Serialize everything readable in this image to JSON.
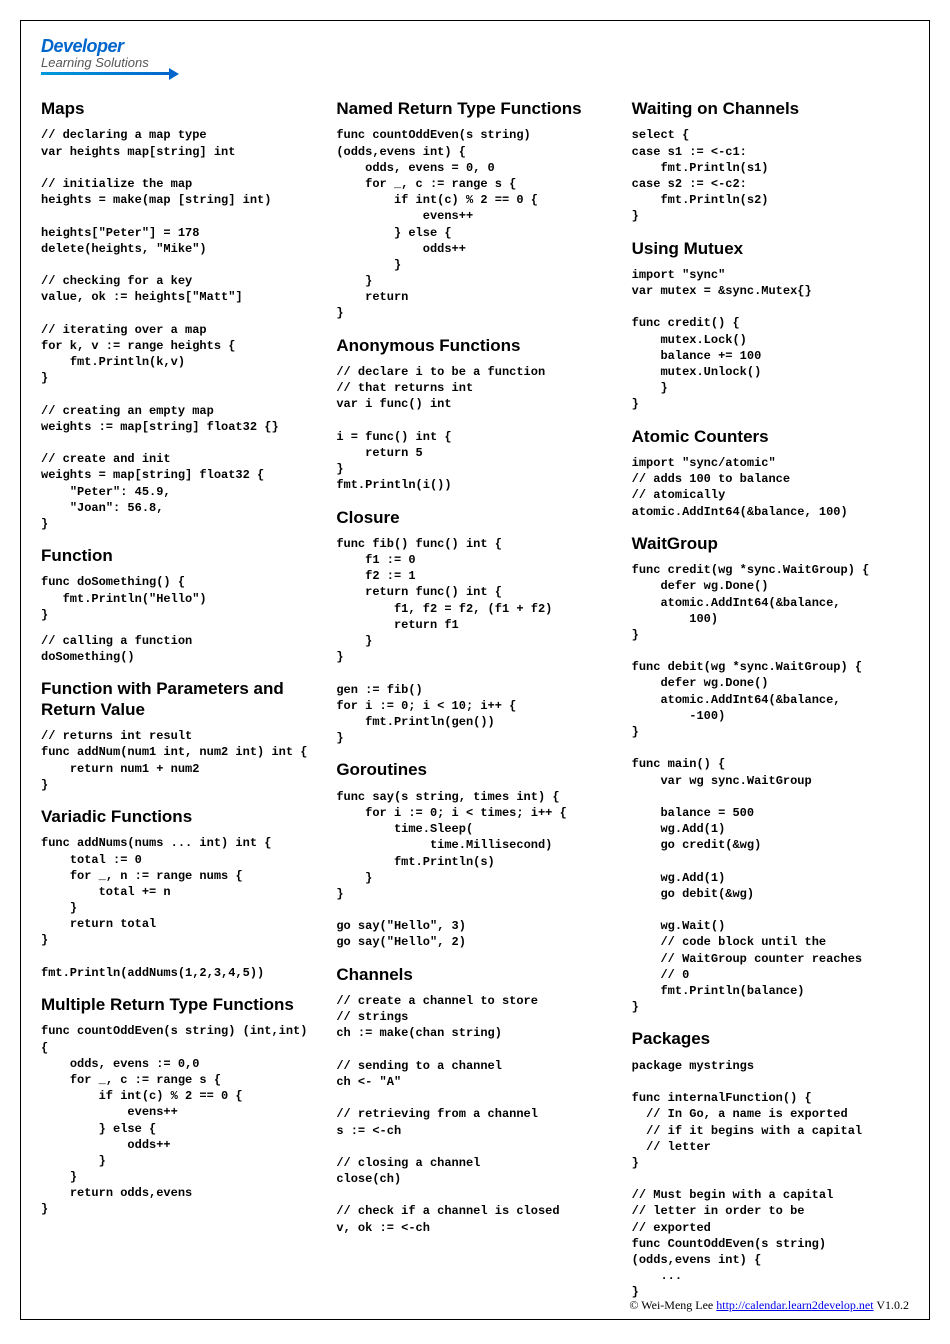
{
  "logo": {
    "line1": "Developer",
    "line2": "Learning Solutions"
  },
  "col1": {
    "h_maps": "Maps",
    "code_maps": "// declaring a map type\nvar heights map[string] int\n\n// initialize the map\nheights = make(map [string] int)\n\nheights[\"Peter\"] = 178\ndelete(heights, \"Mike\")\n\n// checking for a key\nvalue, ok := heights[\"Matt\"]\n\n// iterating over a map\nfor k, v := range heights {\n    fmt.Println(k,v)\n}\n\n// creating an empty map\nweights := map[string] float32 {}\n\n// create and init\nweights = map[string] float32 {\n    \"Peter\": 45.9,\n    \"Joan\": 56.8,\n}",
    "h_function": "Function",
    "code_function1": "func doSomething() {\n   fmt.Println(\"Hello\")\n}",
    "code_function2": "// calling a function\ndoSomething()",
    "h_funcparams": "Function with Parameters and Return Value",
    "code_funcparams": "// returns int result\nfunc addNum(num1 int, num2 int) int {\n    return num1 + num2\n}",
    "h_variadic": "Variadic Functions",
    "code_variadic": "func addNums(nums ... int) int {\n    total := 0\n    for _, n := range nums {\n        total += n\n    }\n    return total\n}\n\nfmt.Println(addNums(1,2,3,4,5))",
    "h_multireturn": "Multiple Return Type Functions",
    "code_multireturn": "func countOddEven(s string) (int,int) {\n    odds, evens := 0,0\n    for _, c := range s {\n        if int(c) % 2 == 0 {\n            evens++\n        } else {\n            odds++\n        }\n    }\n    return odds,evens\n}"
  },
  "col2": {
    "h_named": "Named Return Type Functions",
    "code_named": "func countOddEven(s string) (odds,evens int) {\n    odds, evens = 0, 0\n    for _, c := range s {\n        if int(c) % 2 == 0 {\n            evens++\n        } else {\n            odds++\n        }\n    }\n    return\n}",
    "h_anon": "Anonymous Functions",
    "code_anon": "// declare i to be a function\n// that returns int\nvar i func() int\n\ni = func() int {\n    return 5\n}\nfmt.Println(i())",
    "h_closure": "Closure",
    "code_closure": "func fib() func() int {\n    f1 := 0\n    f2 := 1\n    return func() int {\n        f1, f2 = f2, (f1 + f2)\n        return f1\n    }\n}\n\ngen := fib()\nfor i := 0; i < 10; i++ {\n    fmt.Println(gen())\n}",
    "h_goroutines": "Goroutines",
    "code_goroutines": "func say(s string, times int) {\n    for i := 0; i < times; i++ {\n        time.Sleep(\n             time.Millisecond)\n        fmt.Println(s)\n    }\n}\n\ngo say(\"Hello\", 3)\ngo say(\"Hello\", 2)",
    "h_channels": "Channels",
    "code_channels": "// create a channel to store\n// strings\nch := make(chan string)\n\n// sending to a channel\nch <- \"A\"\n\n// retrieving from a channel\ns := <-ch\n\n// closing a channel\nclose(ch)\n\n// check if a channel is closed\nv, ok := <-ch"
  },
  "col3": {
    "h_waiting": "Waiting on Channels",
    "code_waiting": "select {\ncase s1 := <-c1:\n    fmt.Println(s1)\ncase s2 := <-c2:\n    fmt.Println(s2)\n}",
    "h_mutex": "Using Mutuex",
    "code_mutex": "import \"sync\"\nvar mutex = &sync.Mutex{}\n\nfunc credit() {\n    mutex.Lock()\n    balance += 100\n    mutex.Unlock()\n    }\n}",
    "h_atomic": "Atomic Counters",
    "code_atomic": "import \"sync/atomic\"\n// adds 100 to balance\n// atomically\natomic.AddInt64(&balance, 100)",
    "h_waitgroup": "WaitGroup",
    "code_waitgroup": "func credit(wg *sync.WaitGroup) {\n    defer wg.Done()\n    atomic.AddInt64(&balance,\n        100)\n}\n\nfunc debit(wg *sync.WaitGroup) {\n    defer wg.Done()\n    atomic.AddInt64(&balance,\n        -100)\n}\n\nfunc main() {\n    var wg sync.WaitGroup\n\n    balance = 500\n    wg.Add(1)\n    go credit(&wg)\n\n    wg.Add(1)\n    go debit(&wg)\n\n    wg.Wait()\n    // code block until the\n    // WaitGroup counter reaches\n    // 0\n    fmt.Println(balance)\n}",
    "h_packages": "Packages",
    "code_packages": "package mystrings\n\nfunc internalFunction() {\n  // In Go, a name is exported\n  // if it begins with a capital\n  // letter\n}\n\n// Must begin with a capital\n// letter in order to be\n// exported\nfunc CountOddEven(s string) (odds,evens int) {\n    ...\n}"
  },
  "footer": {
    "prefix": "© Wei-Meng Lee ",
    "link": "http://calendar.learn2develop.net",
    "suffix": " V1.0.2"
  }
}
